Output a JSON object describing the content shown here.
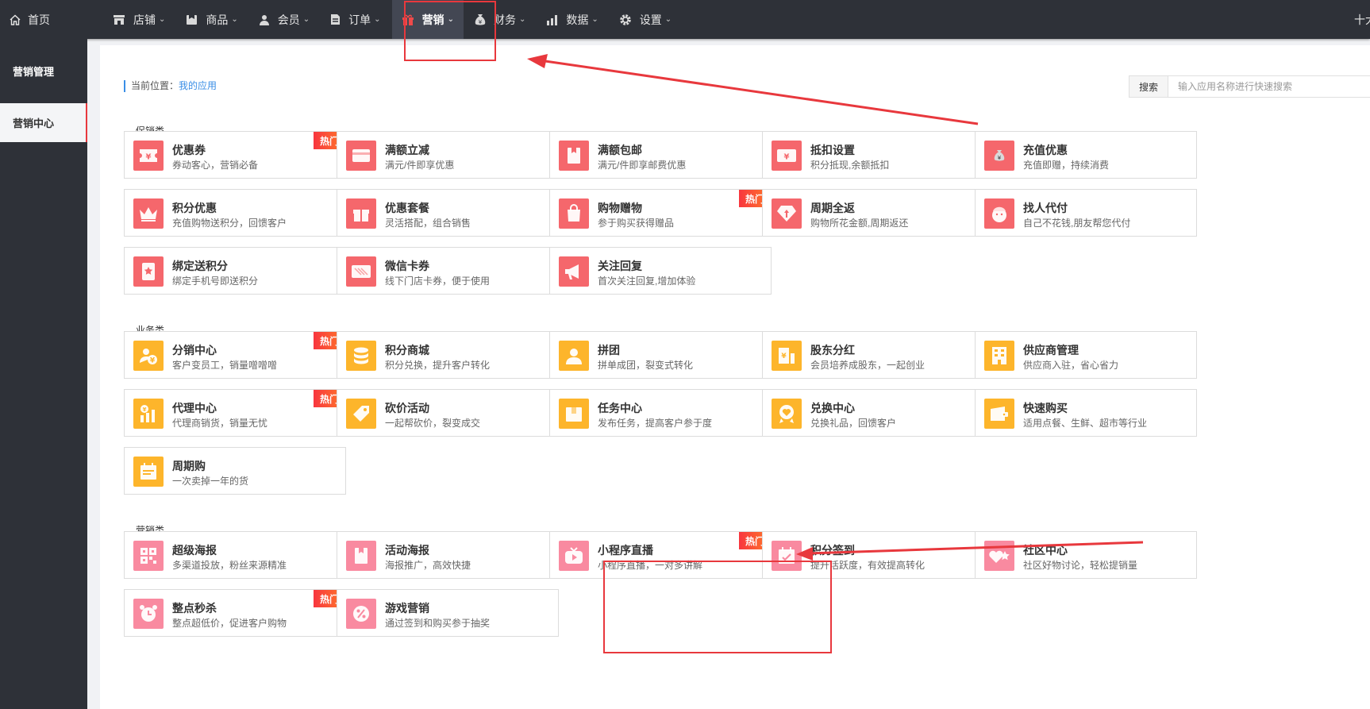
{
  "nav": {
    "home": "首页",
    "items": [
      {
        "label": "店铺",
        "icon": "store-icon"
      },
      {
        "label": "商品",
        "icon": "goods-icon"
      },
      {
        "label": "会员",
        "icon": "user-icon"
      },
      {
        "label": "订单",
        "icon": "order-icon"
      },
      {
        "label": "营销",
        "icon": "gift-icon",
        "active": true
      },
      {
        "label": "财务",
        "icon": "money-bag-icon"
      },
      {
        "label": "数据",
        "icon": "bar-chart-icon"
      },
      {
        "label": "设置",
        "icon": "gear-icon"
      }
    ],
    "right_text": "十大"
  },
  "sidebar": {
    "items": [
      {
        "label": "营销管理"
      },
      {
        "label": "营销中心",
        "active": true
      }
    ]
  },
  "breadcrumb": {
    "prefix": "当前位置：",
    "link": "我的应用"
  },
  "search": {
    "label": "搜索",
    "placeholder": "输入应用名称进行快速搜索"
  },
  "badge_text": "热门",
  "sections": [
    {
      "title": "促销类",
      "apps": [
        {
          "title": "优惠券",
          "desc": "券动客心，营销必备",
          "hot": true,
          "icon": "ticket-icon",
          "color": "red"
        },
        {
          "title": "满额立减",
          "desc": "满元/件即享优惠",
          "icon": "wallet-icon",
          "color": "red"
        },
        {
          "title": "满额包邮",
          "desc": "满元/件即享邮费优惠",
          "icon": "package-icon",
          "color": "red"
        },
        {
          "title": "抵扣设置",
          "desc": "积分抵现,余额抵扣",
          "icon": "yuan-card-icon",
          "color": "red"
        },
        {
          "title": "充值优惠",
          "desc": "充值即赠，持续消费",
          "icon": "money-bag-icon",
          "color": "red"
        },
        {
          "title": "积分优惠",
          "desc": "充值购物送积分，回馈客户",
          "icon": "crown-icon",
          "color": "red"
        },
        {
          "title": "优惠套餐",
          "desc": "灵活搭配，组合销售",
          "icon": "gift-box-icon",
          "color": "red"
        },
        {
          "title": "购物赠物",
          "desc": "参于购买获得赠品",
          "hot": true,
          "icon": "shopping-bag-icon",
          "color": "red"
        },
        {
          "title": "周期全返",
          "desc": "购物所花金额,周期返还",
          "icon": "diamond-icon",
          "color": "red"
        },
        {
          "title": "找人代付",
          "desc": "自己不花钱,朋友帮您代付",
          "icon": "santa-icon",
          "color": "red"
        },
        {
          "title": "绑定送积分",
          "desc": "绑定手机号即送积分",
          "icon": "phone-star-icon",
          "color": "red"
        },
        {
          "title": "微信卡券",
          "desc": "线下门店卡券，便于使用",
          "icon": "card-icon",
          "color": "red"
        },
        {
          "title": "关注回复",
          "desc": "首次关注回复,增加体验",
          "icon": "megaphone-icon",
          "color": "red"
        }
      ]
    },
    {
      "title": "业务类",
      "apps": [
        {
          "title": "分销中心",
          "desc": "客户变员工，销量噌噌噌",
          "hot": true,
          "icon": "distributor-icon",
          "color": "yellow"
        },
        {
          "title": "积分商城",
          "desc": "积分兑换，提升客户转化",
          "icon": "coins-icon",
          "color": "yellow"
        },
        {
          "title": "拼团",
          "desc": "拼单成团，裂变式转化",
          "icon": "group-icon",
          "color": "yellow"
        },
        {
          "title": "股东分红",
          "desc": "会员培养成股东，一起创业",
          "icon": "dividend-icon",
          "color": "yellow"
        },
        {
          "title": "供应商管理",
          "desc": "供应商入驻，省心省力",
          "icon": "building-icon",
          "color": "yellow"
        },
        {
          "title": "代理中心",
          "desc": "代理商销货，销量无忧",
          "hot": true,
          "icon": "agent-chart-icon",
          "color": "yellow"
        },
        {
          "title": "砍价活动",
          "desc": "一起帮砍价，裂变成交",
          "icon": "price-tag-icon",
          "color": "yellow"
        },
        {
          "title": "任务中心",
          "desc": "发布任务，提高客户参于度",
          "icon": "task-box-icon",
          "color": "yellow"
        },
        {
          "title": "兑换中心",
          "desc": "兑换礼品，回馈客户",
          "icon": "heart-badge-icon",
          "color": "yellow"
        },
        {
          "title": "快速购买",
          "desc": "适用点餐、生鲜、超市等行业",
          "icon": "quick-buy-icon",
          "color": "yellow"
        },
        {
          "title": "周期购",
          "desc": "一次卖掉一年的货",
          "icon": "calendar-list-icon",
          "color": "yellow"
        }
      ]
    },
    {
      "title": "营销类",
      "apps": [
        {
          "title": "超级海报",
          "desc": "多渠道投放，粉丝来源精准",
          "icon": "qrcode-icon",
          "color": "pink"
        },
        {
          "title": "活动海报",
          "desc": "海报推广，高效快捷",
          "icon": "poster-icon",
          "color": "pink"
        },
        {
          "title": "小程序直播",
          "desc": "小程序直播，一对多讲解",
          "hot": true,
          "icon": "tv-play-icon",
          "color": "pink"
        },
        {
          "title": "积分签到",
          "desc": "提升活跃度，有效提高转化",
          "icon": "calendar-check-icon",
          "color": "pink"
        },
        {
          "title": "社区中心",
          "desc": "社区好物讨论，轻松提销量",
          "icon": "heart-star-icon",
          "color": "pink"
        },
        {
          "title": "整点秒杀",
          "desc": "整点超低价，促进客户购物",
          "hot": true,
          "icon": "alarm-clock-icon",
          "color": "pink"
        },
        {
          "title": "游戏营销",
          "desc": "通过签到和购买参于抽奖",
          "icon": "percent-icon",
          "color": "pink"
        }
      ]
    }
  ]
}
